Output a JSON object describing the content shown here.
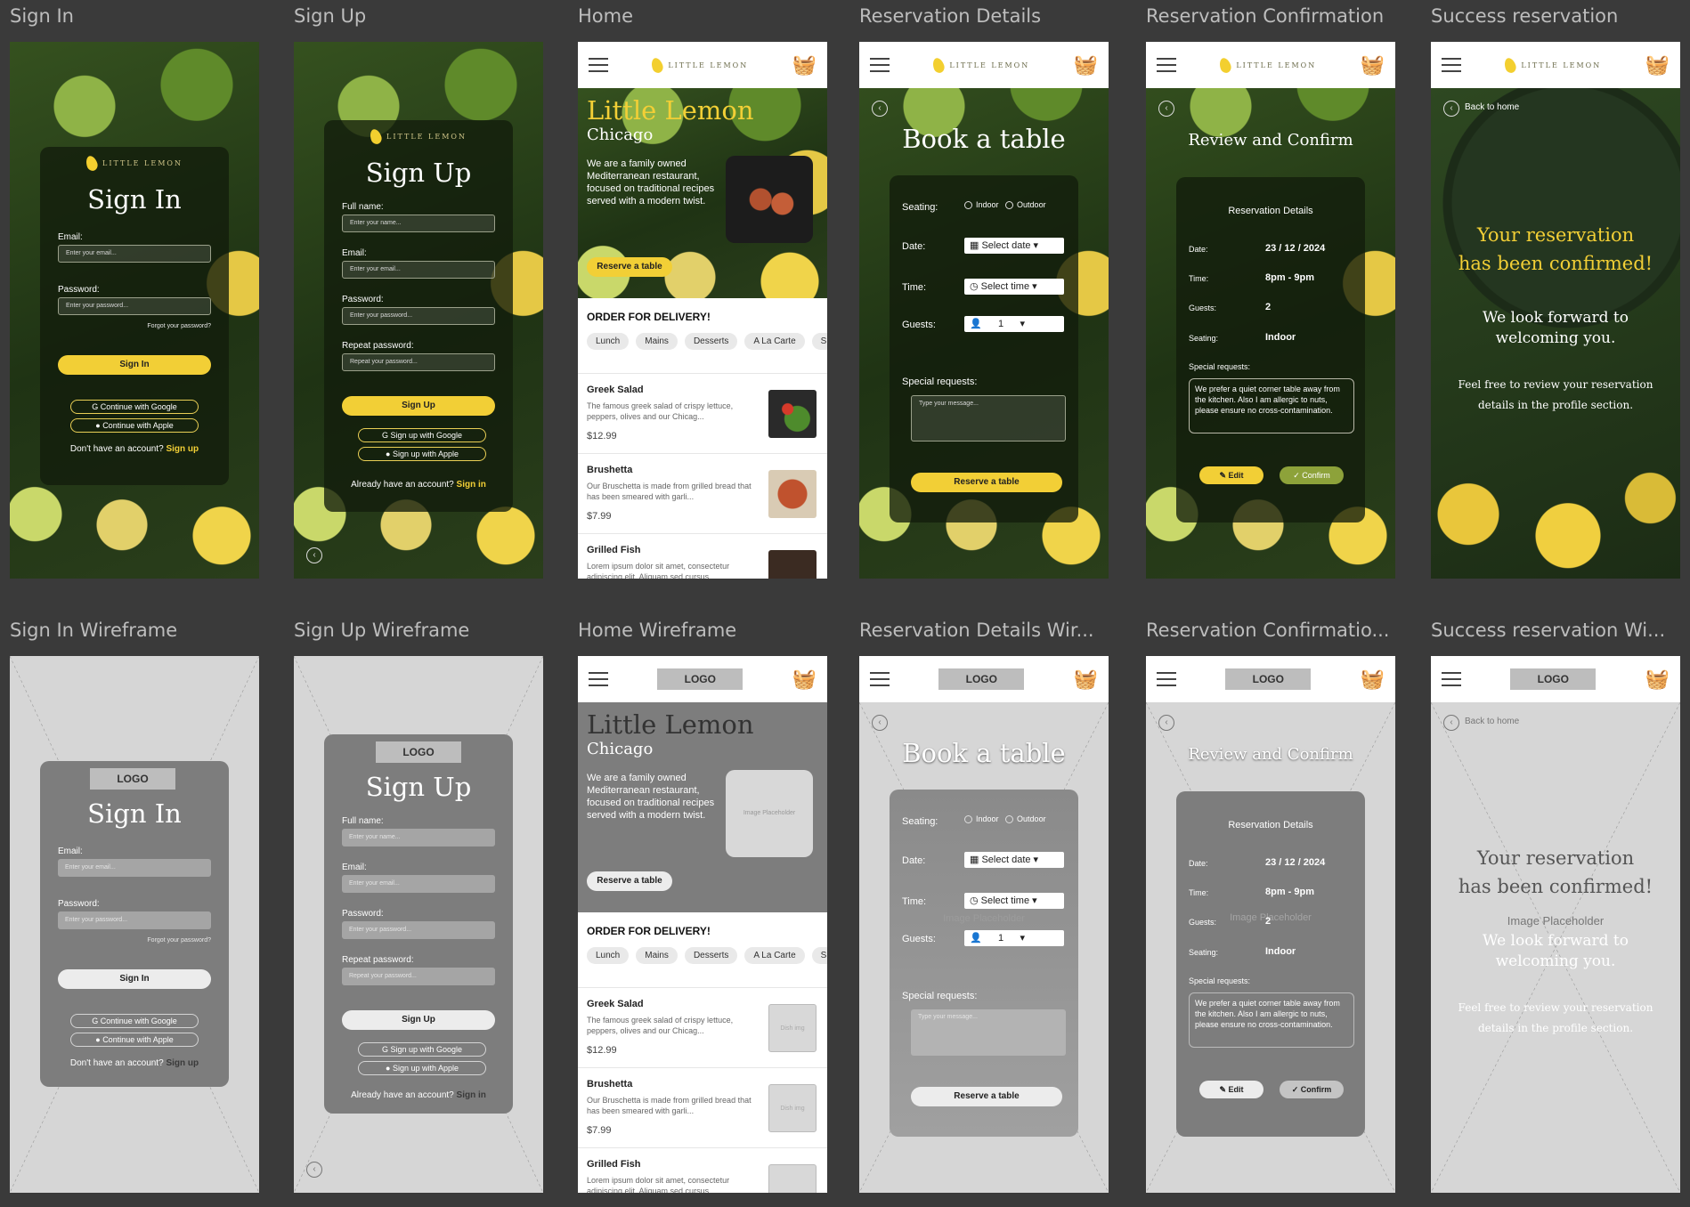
{
  "frames": {
    "signin": "Sign In",
    "signup": "Sign Up",
    "home": "Home",
    "resdetails": "Reservation Details",
    "resconfirm": "Reservation Confirmation",
    "success": "Success reservation",
    "signin_w": "Sign In Wireframe",
    "signup_w": "Sign Up Wireframe",
    "home_w": "Home Wireframe",
    "resdetails_w": "Reservation Details Wir...",
    "resconfirm_w": "Reservation Confirmatio...",
    "success_w": "Success reservation Wi..."
  },
  "brand": {
    "name": "LITTLE LEMON",
    "logo_placeholder": "LOGO",
    "accent": "#f2cf36"
  },
  "signin": {
    "title": "Sign In",
    "email_label": "Email:",
    "email_placeholder": "Enter your email...",
    "password_label": "Password:",
    "password_placeholder": "Enter your password...",
    "forgot": "Forgot your password?",
    "submit": "Sign In",
    "google": "Continue with Google",
    "apple": "Continue with Apple",
    "footer_text": "Don't have an account?",
    "footer_link": "Sign up"
  },
  "signup": {
    "title": "Sign Up",
    "name_label": "Full name:",
    "name_placeholder": "Enter your name...",
    "email_label": "Email:",
    "email_placeholder": "Enter your email...",
    "password_label": "Password:",
    "password_placeholder": "Enter your password...",
    "repeat_label": "Repeat password:",
    "repeat_placeholder": "Repeat your password...",
    "submit": "Sign Up",
    "google": "Sign up with Google",
    "apple": "Sign up with Apple",
    "footer_text": "Already have an account?",
    "footer_link": "Sign in"
  },
  "home": {
    "title": "Little Lemon",
    "city": "Chicago",
    "description": "We are a family owned Mediterranean restaurant, focused on traditional recipes served with a modern twist.",
    "reserve": "Reserve a table",
    "image_placeholder": "Image Placeholder",
    "order_heading": "ORDER FOR DELIVERY!",
    "categories": [
      "Lunch",
      "Mains",
      "Desserts",
      "A La Carte",
      "Specials"
    ],
    "dish_img": "Dish img",
    "dishes": [
      {
        "name": "Greek Salad",
        "desc": "The famous greek salad of crispy lettuce, peppers, olives and our Chicag...",
        "price": "$12.99"
      },
      {
        "name": "Brushetta",
        "desc": "Our Bruschetta is made from grilled bread that has been smeared with garli...",
        "price": "$7.99"
      },
      {
        "name": "Grilled Fish",
        "desc": "Lorem ipsum dolor sit amet, consectetur adipiscing elit. Aliquam sed cursus",
        "price": ""
      }
    ]
  },
  "reservation": {
    "title": "Book a table",
    "seating_label": "Seating:",
    "indoor": "Indoor",
    "outdoor": "Outdoor",
    "date_label": "Date:",
    "date_value": "Select date",
    "time_label": "Time:",
    "time_value": "Select time",
    "guests_label": "Guests:",
    "guests_value": "1",
    "special_label": "Special requests:",
    "special_placeholder": "Type your message...",
    "submit": "Reserve a table",
    "image_placeholder": "Image Placeholder"
  },
  "confirm": {
    "title": "Review and Confirm",
    "panel_title": "Reservation Details",
    "date_label": "Date:",
    "date": "23 / 12 / 2024",
    "time_label": "Time:",
    "time": "8pm - 9pm",
    "guests_label": "Guests:",
    "guests": "2",
    "seating_label": "Seating:",
    "seating": "Indoor",
    "special_label": "Special requests:",
    "special": "We prefer a quiet corner table away from the kitchen. Also I am allergic to nuts, please ensure no cross-contamination.",
    "edit": "Edit",
    "confirm": "Confirm",
    "image_placeholder": "Image Placeholder"
  },
  "success": {
    "back": "Back to home",
    "headline1": "Your reservation",
    "headline2": "has been confirmed!",
    "sub1": "We look forward to",
    "sub2": "welcoming you.",
    "note1": "Feel free to review your reservation",
    "note2": "details in the profile section.",
    "image_placeholder": "Image Placeholder"
  }
}
